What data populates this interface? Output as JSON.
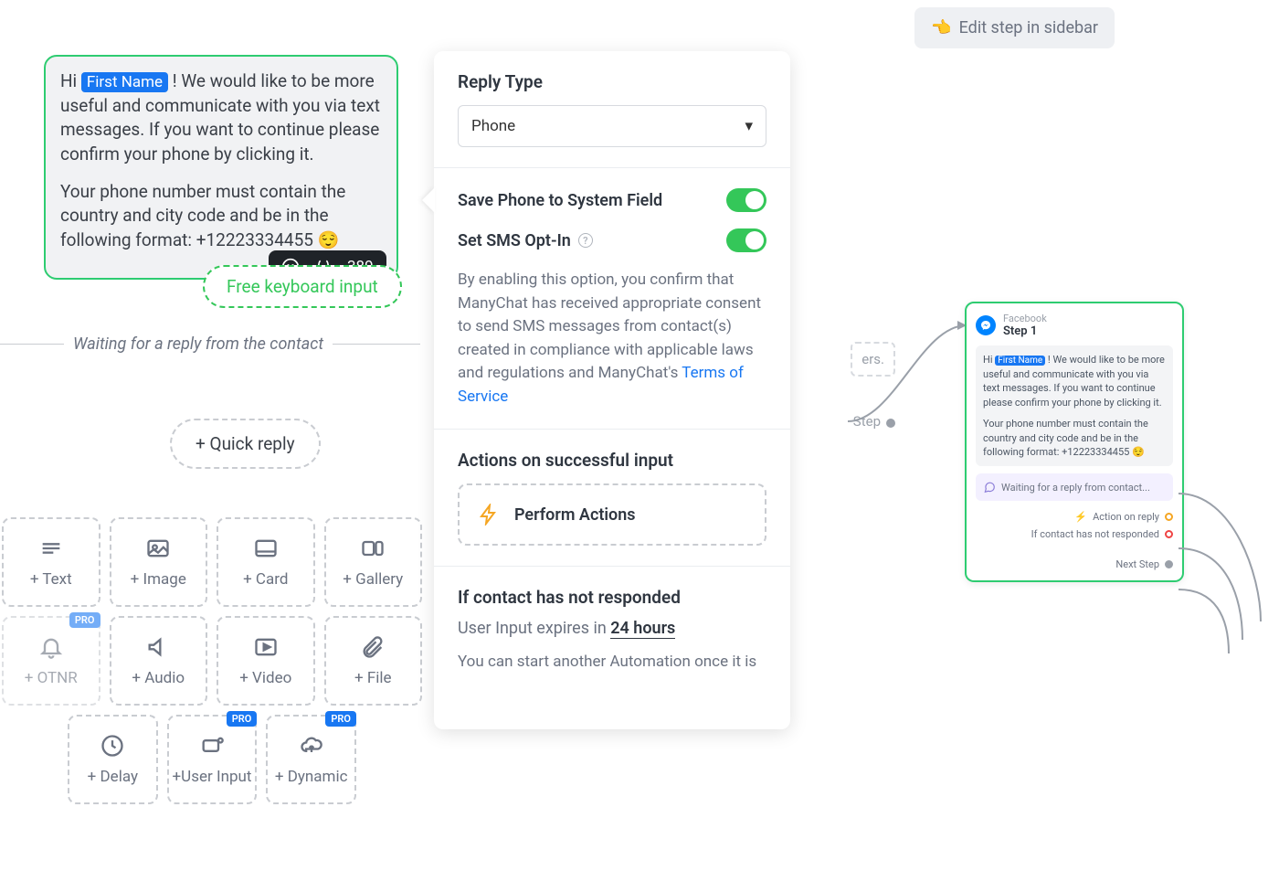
{
  "hint": {
    "pointer": "👈",
    "label": "Edit step in sidebar"
  },
  "message": {
    "token": "First Name",
    "part1": "Hi ",
    "part2": " ! We would like to be more useful and communicate with you via text messages. If you want to continue please confirm your phone by clicking it.",
    "part3": "Your phone number must contain the country and city code and be in the following format: +12223334455 😌",
    "char_count": "389"
  },
  "pills": {
    "free_kb": "Free keyboard input",
    "quick_reply": "+ Quick reply"
  },
  "waiting": "Waiting for a reply from the contact",
  "blocks": {
    "text": "+ Text",
    "image": "+ Image",
    "card": "+ Card",
    "gallery": "+ Gallery",
    "otnr": "+ OTNR",
    "audio": "+ Audio",
    "video": "+ Video",
    "file": "+ File",
    "delay": "+ Delay",
    "userinput": "+User Input",
    "dynamic": "+ Dynamic",
    "pro": "PRO"
  },
  "panel": {
    "reply_type_label": "Reply Type",
    "reply_type_value": "Phone",
    "save_phone": "Save Phone to System Field",
    "set_sms": "Set SMS Opt-In",
    "desc_pre": "By enabling this option, you confirm that ManyChat has received appropriate consent to send SMS messages from contact(s) created in compliance with applicable laws and regulations and ManyChat's ",
    "tos": "Terms of Service",
    "actions_label": "Actions on successful input",
    "perform": "Perform Actions",
    "noresponse": "If contact has not responded",
    "expire_pre": "User Input expires in ",
    "expire_val": "24 hours",
    "start_another": "You can start another Automation once it is"
  },
  "canvas": {
    "ers": "ers.",
    "step": "Step",
    "next_step": "Next Step"
  },
  "card": {
    "platform": "Facebook",
    "title": "Step 1",
    "token": "First Name",
    "body1": "Hi ",
    "body2": " ! We would like to be more useful and communicate with you via text messages. If you want to continue please confirm your phone by clicking it.",
    "body3": "Your phone number must contain the country and city code and be in the following format: +12223334455 😌",
    "waiting": "Waiting for a reply from contact...",
    "action_on_reply": "Action on reply",
    "noresponse": "If contact has not responded"
  }
}
